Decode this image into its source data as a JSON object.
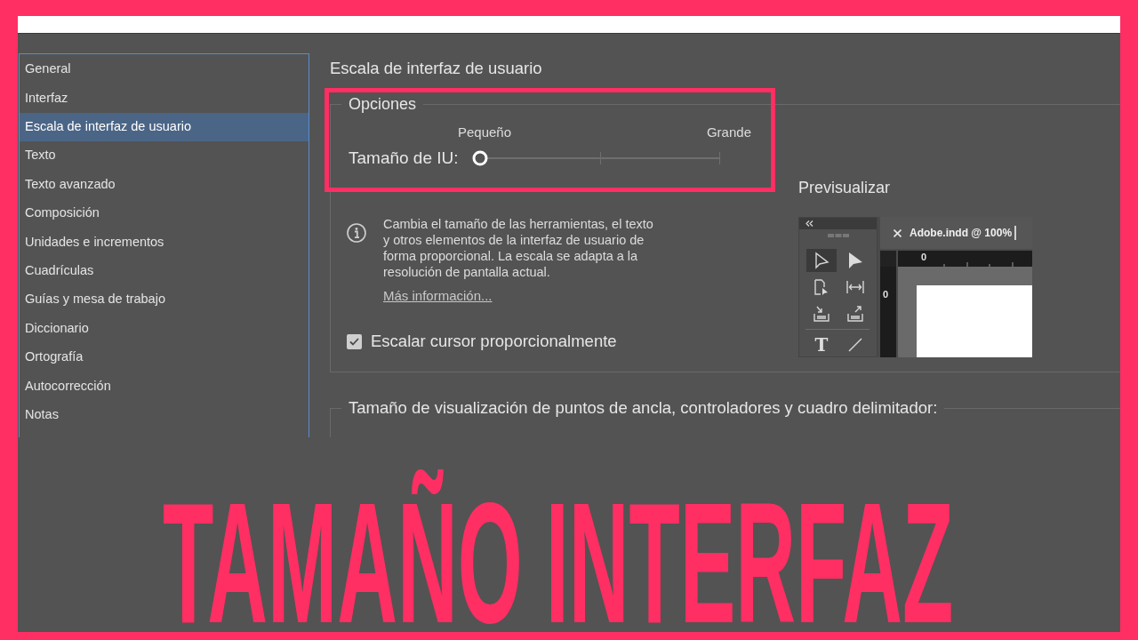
{
  "sidebar": {
    "items": [
      {
        "label": "General",
        "selected": false
      },
      {
        "label": "Interfaz",
        "selected": false
      },
      {
        "label": "Escala de interfaz de usuario",
        "selected": true
      },
      {
        "label": "Texto",
        "selected": false
      },
      {
        "label": "Texto avanzado",
        "selected": false
      },
      {
        "label": "Composición",
        "selected": false
      },
      {
        "label": "Unidades e incrementos",
        "selected": false
      },
      {
        "label": "Cuadrículas",
        "selected": false
      },
      {
        "label": "Guías y mesa de trabajo",
        "selected": false
      },
      {
        "label": "Diccionario",
        "selected": false
      },
      {
        "label": "Ortografía",
        "selected": false
      },
      {
        "label": "Autocorrección",
        "selected": false
      },
      {
        "label": "Notas",
        "selected": false
      }
    ]
  },
  "panel": {
    "title": "Escala de interfaz de usuario",
    "options": {
      "legend": "Opciones",
      "slider": {
        "label": "Tamaño de IU:",
        "min_label": "Pequeño",
        "max_label": "Grande",
        "level": 0
      },
      "info": {
        "text": "Cambia el tamaño de las herramientas, el texto y otros elementos de la interfaz de usuario de forma proporcional. La escala se adapta a la resolución de pantalla actual.",
        "link": "Más información..."
      },
      "checkbox": {
        "label": "Escalar cursor proporcionalmente",
        "checked": true
      },
      "preview": {
        "title": "Previsualizar",
        "document_tab": "Adobe.indd @ 100%",
        "type_tool": "T",
        "horizontal_ruler": "0",
        "vertical_ruler": "0"
      }
    },
    "anchor_section": {
      "legend": "Tamaño de visualización de puntos de ancla, controladores y cuadro delimitador:"
    }
  },
  "caption": "TAMAÑO INTERFAZ"
}
